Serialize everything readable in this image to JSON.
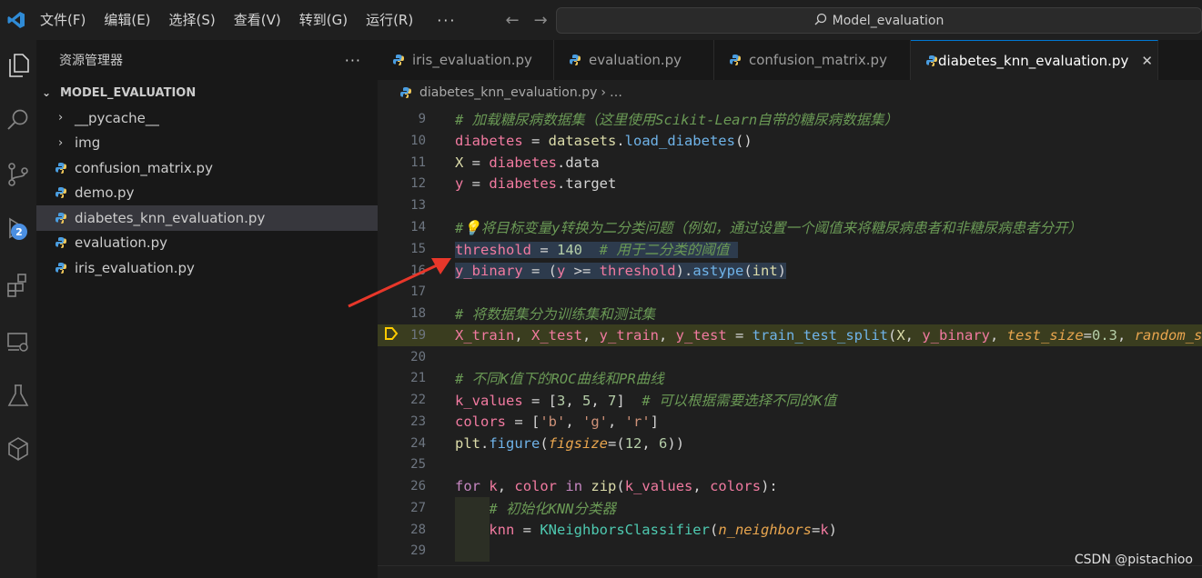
{
  "window": {
    "search_text": "Model_evaluation"
  },
  "menu": [
    "文件(F)",
    "编辑(E)",
    "选择(S)",
    "查看(V)",
    "转到(G)",
    "运行(R)"
  ],
  "menu_more": "···",
  "activity": {
    "run_badge": "2"
  },
  "sidebar": {
    "title": "资源管理器",
    "more": "···",
    "root": "MODEL_EVALUATION",
    "folders": [
      "__pycache__",
      "img"
    ],
    "files": [
      "confusion_matrix.py",
      "demo.py",
      "diabetes_knn_evaluation.py",
      "evaluation.py",
      "iris_evaluation.py"
    ],
    "selected_file": "diabetes_knn_evaluation.py"
  },
  "tabs": [
    {
      "label": "iris_evaluation.py"
    },
    {
      "label": "evaluation.py"
    },
    {
      "label": "confusion_matrix.py"
    },
    {
      "label": "diabetes_knn_evaluation.py"
    }
  ],
  "breadcrumb": {
    "file": "diabetes_knn_evaluation.py",
    "tail": "…"
  },
  "editor": {
    "line_numbers": [
      "9",
      "10",
      "11",
      "12",
      "13",
      "14",
      "15",
      "16",
      "17",
      "18",
      "19",
      "20",
      "21",
      "22",
      "23",
      "24",
      "25",
      "26",
      "27",
      "28",
      "29"
    ]
  },
  "watermark": "CSDN @pistachioo",
  "colors": {
    "accent": "#0078d4",
    "badge": "#4b8fe2",
    "arrow": "#e8372a",
    "debug_marker": "#ffcc00"
  }
}
